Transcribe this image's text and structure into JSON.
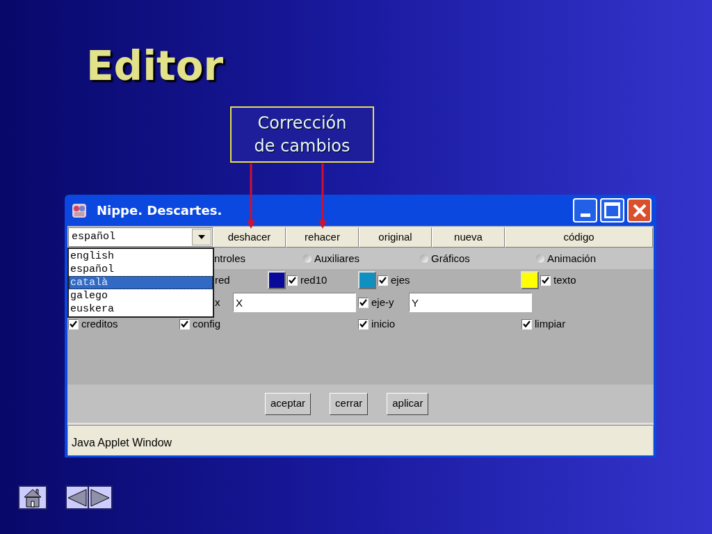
{
  "slide": {
    "title": "Editor",
    "callout_lines": [
      "Corrección",
      "de cambios"
    ]
  },
  "window": {
    "title": "Nippe. Descartes."
  },
  "toolbar": {
    "language_combo": {
      "value": "español",
      "options": [
        {
          "label": "english",
          "highlighted": false
        },
        {
          "label": "español",
          "highlighted": false
        },
        {
          "label": "català",
          "highlighted": true
        },
        {
          "label": "galego",
          "highlighted": false
        },
        {
          "label": "euskera",
          "highlighted": false
        }
      ]
    },
    "buttons": [
      "deshacer",
      "rehacer",
      "original",
      "nueva",
      "código"
    ]
  },
  "rows": [
    [
      {
        "kind": "text",
        "label": "ntroles"
      },
      {
        "kind": "radio",
        "label": "Auxiliares",
        "selected": false
      },
      {
        "kind": "radio",
        "label": "Gráficos",
        "selected": false
      },
      {
        "kind": "radio",
        "label": "Animación",
        "selected": false
      }
    ],
    [
      {
        "kind": "text",
        "label": "red"
      },
      {
        "kind": "swatch",
        "color": "#0a0a9a"
      },
      {
        "kind": "check",
        "label": "red10",
        "checked": true
      },
      {
        "kind": "swatch",
        "color": "#1090c0"
      },
      {
        "kind": "check",
        "label": "ejes",
        "checked": true
      },
      {
        "kind": "swatch",
        "color": "#ffff00"
      },
      {
        "kind": "check",
        "label": "texto",
        "checked": true
      }
    ],
    [
      {
        "kind": "text",
        "label": "x"
      },
      {
        "kind": "field",
        "value": "X"
      },
      {
        "kind": "check",
        "label": "eje-y",
        "checked": true
      },
      {
        "kind": "field",
        "value": "Y"
      }
    ],
    [
      {
        "kind": "check",
        "label": "creditos",
        "checked": true
      },
      {
        "kind": "check",
        "label": "config",
        "checked": true
      },
      {
        "kind": "check",
        "label": "inicio",
        "checked": true
      },
      {
        "kind": "check",
        "label": "limpiar",
        "checked": true
      }
    ]
  ],
  "dialog_buttons": [
    "aceptar",
    "cerrar",
    "aplicar"
  ],
  "status_bar": "Java Applet Window"
}
